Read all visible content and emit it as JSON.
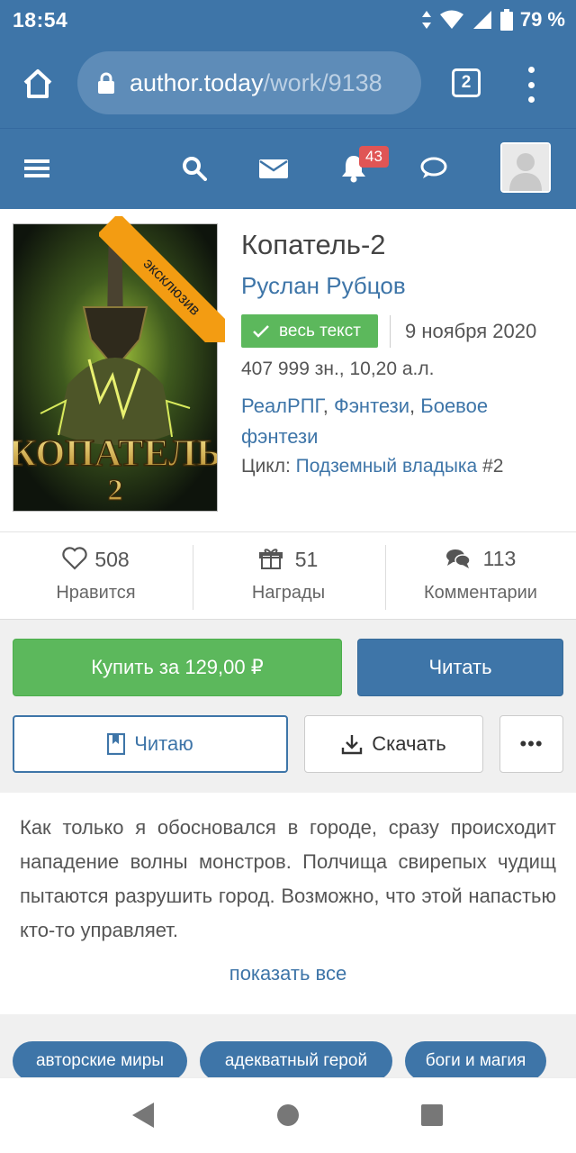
{
  "status_bar": {
    "time": "18:54",
    "battery": "79 %"
  },
  "browser": {
    "url_host": "author.today",
    "url_path": "/work/9138",
    "tab_count": "2"
  },
  "site_header": {
    "notifications_count": "43"
  },
  "book": {
    "ribbon": "эксклюзив",
    "cover_title": "КОПАТЕЛЬ",
    "cover_number": "2",
    "title": "Копатель-2",
    "author": "Руслан Рубцов",
    "status": "весь текст",
    "date": "9 ноября 2020",
    "size": "407 999 зн., 10,20 а.л.",
    "genres": [
      "РеалРПГ",
      "Фэнтези",
      "Боевое фэнтези"
    ],
    "genre_sep": ", ",
    "cycle_label": "Цикл:",
    "cycle_name": "Подземный владыка",
    "cycle_num": "#2"
  },
  "stats": [
    {
      "count": "508",
      "label": "Нравится",
      "icon": "heart-icon"
    },
    {
      "count": "51",
      "label": "Награды",
      "icon": "gift-icon"
    },
    {
      "count": "113",
      "label": "Комментарии",
      "icon": "comments-icon"
    }
  ],
  "actions": {
    "buy": "Купить за 129,00 ₽",
    "read": "Читать",
    "reading": "Читаю",
    "download": "Скачать",
    "more": "•••"
  },
  "description": {
    "text": "Как только я обосновался в городе, сразу происходит нападение волны монстров. Полчища свирепых чудищ пытаются разрушить город. Возможно, что этой напастью кто-то управляет.",
    "show_all": "показать все"
  },
  "tags": [
    "авторские миры",
    "адекватный герой",
    "боги и магия"
  ],
  "colors": {
    "primary": "#3e75a8",
    "success": "#5cb85c",
    "accent": "#f39c12",
    "danger": "#e05555"
  }
}
